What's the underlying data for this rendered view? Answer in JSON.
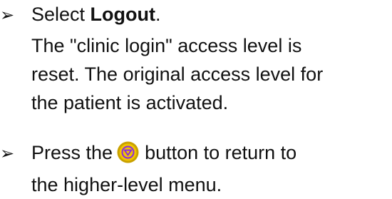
{
  "step1": {
    "bullet_icon": "arrow-right-icon",
    "prefix": "Select ",
    "emphasis": "Logout",
    "suffix": ".",
    "lines": [
      "The \"clinic login\" access level is",
      "reset. The original access level for",
      "the patient is activated."
    ]
  },
  "step2": {
    "bullet_icon": "arrow-right-icon",
    "before_icon": "Press the",
    "button_icon": "back-down-button-icon",
    "after_icon": "button to return to",
    "line2": "the higher-level menu."
  },
  "colors": {
    "button_ring": "#c9a100",
    "button_face": "#f0c500",
    "button_arrow": "#8a2be2"
  }
}
